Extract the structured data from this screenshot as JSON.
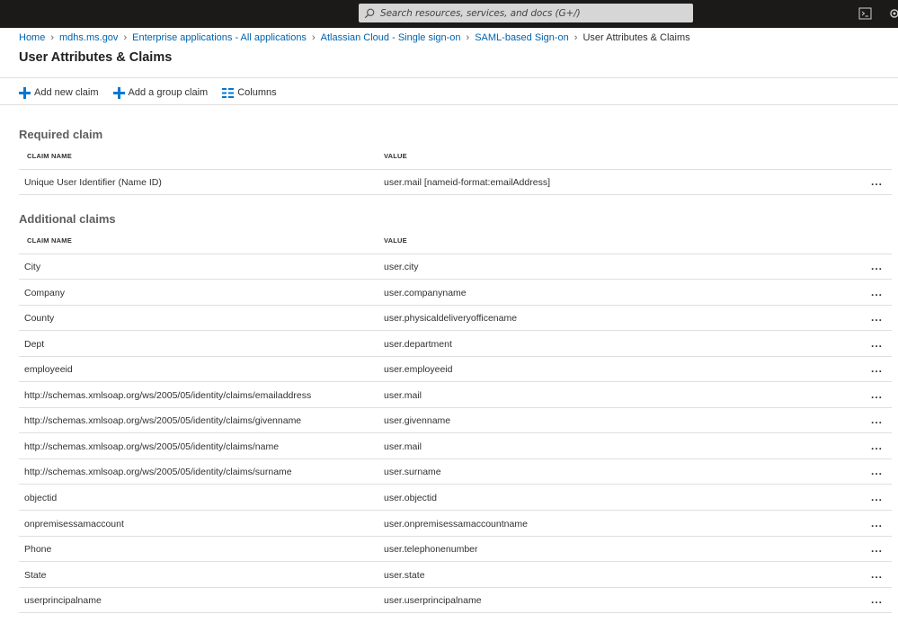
{
  "search": {
    "placeholder": "Search resources, services, and docs (G+/)"
  },
  "breadcrumb": {
    "items": [
      "Home",
      "mdhs.ms.gov",
      "Enterprise applications - All applications",
      "Atlassian Cloud - Single sign-on",
      "SAML-based Sign-on"
    ],
    "current": "User Attributes & Claims"
  },
  "page": {
    "title": "User Attributes & Claims"
  },
  "toolbar": {
    "add_new_claim": "Add new claim",
    "add_group_claim": "Add a group claim",
    "columns": "Columns"
  },
  "required": {
    "title": "Required claim",
    "col_name": "CLAIM NAME",
    "col_value": "VALUE",
    "rows": [
      {
        "name": "Unique User Identifier (Name ID)",
        "value": "user.mail [nameid-format:emailAddress]"
      }
    ]
  },
  "additional": {
    "title": "Additional claims",
    "col_name": "CLAIM NAME",
    "col_value": "VALUE",
    "rows": [
      {
        "name": "City",
        "value": "user.city"
      },
      {
        "name": "Company",
        "value": "user.companyname"
      },
      {
        "name": "County",
        "value": "user.physicaldeliveryofficename"
      },
      {
        "name": "Dept",
        "value": "user.department"
      },
      {
        "name": "employeeid",
        "value": "user.employeeid"
      },
      {
        "name": "http://schemas.xmlsoap.org/ws/2005/05/identity/claims/emailaddress",
        "value": "user.mail"
      },
      {
        "name": "http://schemas.xmlsoap.org/ws/2005/05/identity/claims/givenname",
        "value": "user.givenname"
      },
      {
        "name": "http://schemas.xmlsoap.org/ws/2005/05/identity/claims/name",
        "value": "user.mail"
      },
      {
        "name": "http://schemas.xmlsoap.org/ws/2005/05/identity/claims/surname",
        "value": "user.surname"
      },
      {
        "name": "objectid",
        "value": "user.objectid"
      },
      {
        "name": "onpremisessamaccount",
        "value": "user.onpremisessamaccountname"
      },
      {
        "name": "Phone",
        "value": "user.telephonenumber"
      },
      {
        "name": "State",
        "value": "user.state"
      },
      {
        "name": "userprincipalname",
        "value": "user.userprincipalname"
      }
    ]
  },
  "row_actions": {
    "more": "..."
  },
  "colors": {
    "accent": "#0078d4",
    "link": "#0062ad",
    "topbar": "#1b1a19"
  }
}
